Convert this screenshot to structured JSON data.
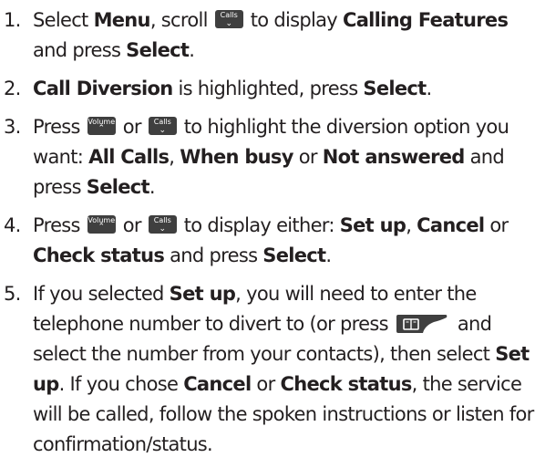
{
  "keys": {
    "calls": {
      "label": "Calls",
      "glyph": "⌄"
    },
    "volume": {
      "label": "Volume",
      "glyph": "⌃"
    }
  },
  "steps": [
    {
      "num": "1.",
      "t1": "Select ",
      "b1": "Menu",
      "t2": ", scroll ",
      "t3": " to display ",
      "b2": "Calling Features",
      "t4": " and press ",
      "b3": "Select",
      "t5": "."
    },
    {
      "num": "2.",
      "b1": "Call Diversion",
      "t1": " is highlighted, press ",
      "b2": "Select",
      "t2": "."
    },
    {
      "num": "3.",
      "t1": "Press ",
      "t2": " or ",
      "t3": " to highlight the diversion option you want: ",
      "b1": "All Calls",
      "t4": ", ",
      "b2": "When busy",
      "t5": " or ",
      "b3": "Not answered",
      "t6": " and press ",
      "b4": "Select",
      "t7": "."
    },
    {
      "num": "4.",
      "t1": "Press ",
      "t2": " or ",
      "t3": " to display either: ",
      "b1": "Set up",
      "t4": ", ",
      "b2": "Cancel",
      "t5": " or ",
      "b3": "Check status",
      "t6": " and press ",
      "b4": "Select",
      "t7": "."
    },
    {
      "num": "5.",
      "t1": "If you selected ",
      "b1": "Set up",
      "t2": ", you will need to enter the telephone number to divert to (or press ",
      "t3": " and select the number from your contacts), then select ",
      "b2": "Set up",
      "t4": ". If you chose ",
      "b3": "Cancel",
      "t5": " or ",
      "b4": "Check status",
      "t6": ", the service will be called, follow the spoken instructions or listen for confirmation/status."
    }
  ]
}
